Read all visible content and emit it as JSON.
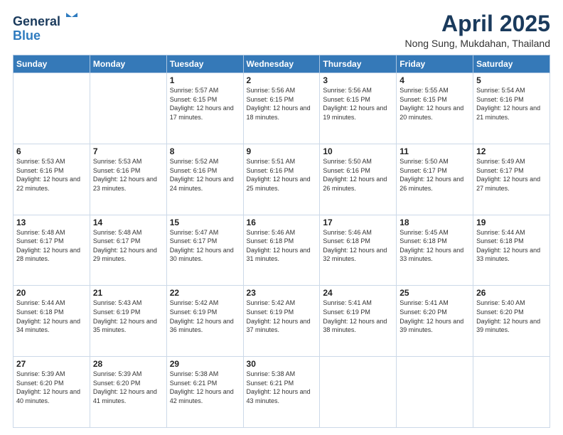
{
  "header": {
    "logo_general": "General",
    "logo_blue": "Blue",
    "month_title": "April 2025",
    "location": "Nong Sung, Mukdahan, Thailand"
  },
  "weekdays": [
    "Sunday",
    "Monday",
    "Tuesday",
    "Wednesday",
    "Thursday",
    "Friday",
    "Saturday"
  ],
  "weeks": [
    [
      {
        "day": "",
        "info": ""
      },
      {
        "day": "",
        "info": ""
      },
      {
        "day": "1",
        "info": "Sunrise: 5:57 AM\nSunset: 6:15 PM\nDaylight: 12 hours and 17 minutes."
      },
      {
        "day": "2",
        "info": "Sunrise: 5:56 AM\nSunset: 6:15 PM\nDaylight: 12 hours and 18 minutes."
      },
      {
        "day": "3",
        "info": "Sunrise: 5:56 AM\nSunset: 6:15 PM\nDaylight: 12 hours and 19 minutes."
      },
      {
        "day": "4",
        "info": "Sunrise: 5:55 AM\nSunset: 6:15 PM\nDaylight: 12 hours and 20 minutes."
      },
      {
        "day": "5",
        "info": "Sunrise: 5:54 AM\nSunset: 6:16 PM\nDaylight: 12 hours and 21 minutes."
      }
    ],
    [
      {
        "day": "6",
        "info": "Sunrise: 5:53 AM\nSunset: 6:16 PM\nDaylight: 12 hours and 22 minutes."
      },
      {
        "day": "7",
        "info": "Sunrise: 5:53 AM\nSunset: 6:16 PM\nDaylight: 12 hours and 23 minutes."
      },
      {
        "day": "8",
        "info": "Sunrise: 5:52 AM\nSunset: 6:16 PM\nDaylight: 12 hours and 24 minutes."
      },
      {
        "day": "9",
        "info": "Sunrise: 5:51 AM\nSunset: 6:16 PM\nDaylight: 12 hours and 25 minutes."
      },
      {
        "day": "10",
        "info": "Sunrise: 5:50 AM\nSunset: 6:16 PM\nDaylight: 12 hours and 26 minutes."
      },
      {
        "day": "11",
        "info": "Sunrise: 5:50 AM\nSunset: 6:17 PM\nDaylight: 12 hours and 26 minutes."
      },
      {
        "day": "12",
        "info": "Sunrise: 5:49 AM\nSunset: 6:17 PM\nDaylight: 12 hours and 27 minutes."
      }
    ],
    [
      {
        "day": "13",
        "info": "Sunrise: 5:48 AM\nSunset: 6:17 PM\nDaylight: 12 hours and 28 minutes."
      },
      {
        "day": "14",
        "info": "Sunrise: 5:48 AM\nSunset: 6:17 PM\nDaylight: 12 hours and 29 minutes."
      },
      {
        "day": "15",
        "info": "Sunrise: 5:47 AM\nSunset: 6:17 PM\nDaylight: 12 hours and 30 minutes."
      },
      {
        "day": "16",
        "info": "Sunrise: 5:46 AM\nSunset: 6:18 PM\nDaylight: 12 hours and 31 minutes."
      },
      {
        "day": "17",
        "info": "Sunrise: 5:46 AM\nSunset: 6:18 PM\nDaylight: 12 hours and 32 minutes."
      },
      {
        "day": "18",
        "info": "Sunrise: 5:45 AM\nSunset: 6:18 PM\nDaylight: 12 hours and 33 minutes."
      },
      {
        "day": "19",
        "info": "Sunrise: 5:44 AM\nSunset: 6:18 PM\nDaylight: 12 hours and 33 minutes."
      }
    ],
    [
      {
        "day": "20",
        "info": "Sunrise: 5:44 AM\nSunset: 6:18 PM\nDaylight: 12 hours and 34 minutes."
      },
      {
        "day": "21",
        "info": "Sunrise: 5:43 AM\nSunset: 6:19 PM\nDaylight: 12 hours and 35 minutes."
      },
      {
        "day": "22",
        "info": "Sunrise: 5:42 AM\nSunset: 6:19 PM\nDaylight: 12 hours and 36 minutes."
      },
      {
        "day": "23",
        "info": "Sunrise: 5:42 AM\nSunset: 6:19 PM\nDaylight: 12 hours and 37 minutes."
      },
      {
        "day": "24",
        "info": "Sunrise: 5:41 AM\nSunset: 6:19 PM\nDaylight: 12 hours and 38 minutes."
      },
      {
        "day": "25",
        "info": "Sunrise: 5:41 AM\nSunset: 6:20 PM\nDaylight: 12 hours and 39 minutes."
      },
      {
        "day": "26",
        "info": "Sunrise: 5:40 AM\nSunset: 6:20 PM\nDaylight: 12 hours and 39 minutes."
      }
    ],
    [
      {
        "day": "27",
        "info": "Sunrise: 5:39 AM\nSunset: 6:20 PM\nDaylight: 12 hours and 40 minutes."
      },
      {
        "day": "28",
        "info": "Sunrise: 5:39 AM\nSunset: 6:20 PM\nDaylight: 12 hours and 41 minutes."
      },
      {
        "day": "29",
        "info": "Sunrise: 5:38 AM\nSunset: 6:21 PM\nDaylight: 12 hours and 42 minutes."
      },
      {
        "day": "30",
        "info": "Sunrise: 5:38 AM\nSunset: 6:21 PM\nDaylight: 12 hours and 43 minutes."
      },
      {
        "day": "",
        "info": ""
      },
      {
        "day": "",
        "info": ""
      },
      {
        "day": "",
        "info": ""
      }
    ]
  ]
}
